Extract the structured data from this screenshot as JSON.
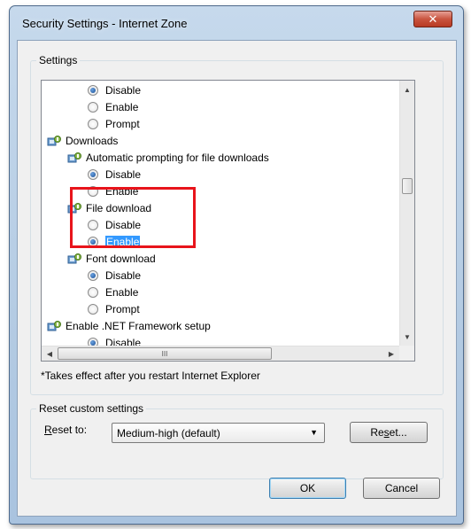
{
  "window": {
    "title": "Security Settings - Internet Zone",
    "close_glyph": "✕"
  },
  "settings_group": {
    "label": "Settings",
    "items": [
      {
        "kind": "radio",
        "label": "Disable",
        "checked": true
      },
      {
        "kind": "radio",
        "label": "Enable",
        "checked": false
      },
      {
        "kind": "radio",
        "label": "Prompt",
        "checked": false
      },
      {
        "kind": "category",
        "label": "Downloads"
      },
      {
        "kind": "subcategory",
        "label": "Automatic prompting for file downloads"
      },
      {
        "kind": "radio",
        "label": "Disable",
        "checked": true
      },
      {
        "kind": "radio",
        "label": "Enable",
        "checked": false
      },
      {
        "kind": "subcategory",
        "label": "File download"
      },
      {
        "kind": "radio",
        "label": "Disable",
        "checked": false
      },
      {
        "kind": "radio",
        "label": "Enable",
        "checked": true,
        "selected": true
      },
      {
        "kind": "subcategory",
        "label": "Font download"
      },
      {
        "kind": "radio",
        "label": "Disable",
        "checked": true
      },
      {
        "kind": "radio",
        "label": "Enable",
        "checked": false
      },
      {
        "kind": "radio",
        "label": "Prompt",
        "checked": false
      },
      {
        "kind": "category",
        "label": "Enable .NET Framework setup"
      },
      {
        "kind": "radio",
        "label": "Disable",
        "checked": true
      }
    ],
    "note": "*Takes effect after you restart Internet Explorer",
    "scroll_up_glyph": "▲",
    "scroll_down_glyph": "▼",
    "scroll_left_glyph": "◀",
    "scroll_right_glyph": "▶",
    "thumb_grip": "III"
  },
  "reset_group": {
    "label": "Reset custom settings",
    "reset_to_prefix": "R",
    "reset_to_rest": "eset to:",
    "selected_value": "Medium-high (default)",
    "dropdown_glyph": "▼",
    "reset_button_prefix": "Re",
    "reset_button_underline": "s",
    "reset_button_rest": "et..."
  },
  "buttons": {
    "ok": "OK",
    "cancel": "Cancel"
  },
  "colors": {
    "selection_blue": "#3399ff",
    "highlight_red": "#e8141b"
  }
}
